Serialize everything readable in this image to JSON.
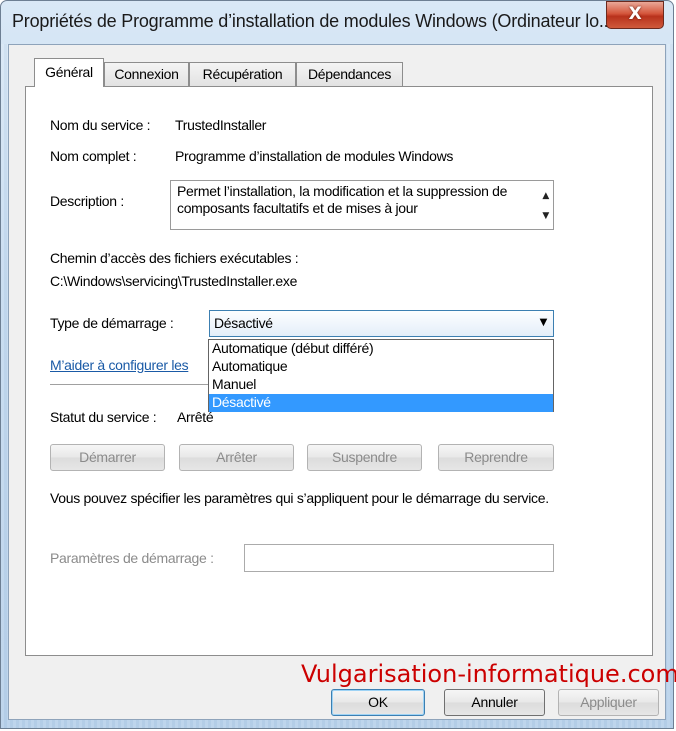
{
  "window": {
    "title": "Propriétés de Programme d’installation de modules Windows (Ordinateur lo...",
    "close_label": "X"
  },
  "tabs": [
    {
      "label": "Général",
      "active": true
    },
    {
      "label": "Connexion",
      "active": false
    },
    {
      "label": "Récupération",
      "active": false
    },
    {
      "label": "Dépendances",
      "active": false
    }
  ],
  "general": {
    "service_name_label": "Nom du service :",
    "service_name_value": "TrustedInstaller",
    "display_name_label": "Nom complet :",
    "display_name_value": "Programme d’installation de modules Windows",
    "description_label": "Description :",
    "description_value": "Permet l’installation, la modification et la suppression de composants facultatifs et de mises à jour",
    "exe_path_label": "Chemin d’accès des fichiers exécutables :",
    "exe_path_value": "C:\\Windows\\servicing\\TrustedInstaller.exe",
    "startup_type_label": "Type de démarrage :",
    "startup_type_value": "Désactivé",
    "startup_type_options": [
      "Automatique (début différé)",
      "Automatique",
      "Manuel",
      "Désactivé"
    ],
    "help_link": "M’aider à configurer les",
    "status_label": "Statut du service :",
    "status_value": "Arrêté",
    "buttons": {
      "start": "Démarrer",
      "stop": "Arrêter",
      "pause": "Suspendre",
      "resume": "Reprendre"
    },
    "params_hint": "Vous pouvez spécifier les paramètres qui s’appliquent pour le démarrage du service.",
    "params_label": "Paramètres de démarrage :",
    "params_value": ""
  },
  "footer": {
    "ok": "OK",
    "cancel": "Annuler",
    "apply": "Appliquer"
  },
  "watermark": "Vulgarisation-informatique.com"
}
